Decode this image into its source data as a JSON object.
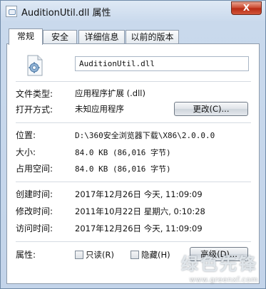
{
  "window": {
    "title": "AuditionUtil.dll 属性",
    "close_label": "X"
  },
  "tabs": [
    {
      "label": "常规",
      "active": true
    },
    {
      "label": "安全",
      "active": false
    },
    {
      "label": "详细信息",
      "active": false
    },
    {
      "label": "以前的版本",
      "active": false
    }
  ],
  "general": {
    "filename": "AuditionUtil.dll",
    "file_type_label": "文件类型:",
    "file_type_value": "应用程序扩展 (.dll)",
    "open_with_label": "打开方式:",
    "open_with_value": "未知应用程序",
    "change_button": "更改(C)...",
    "location_label": "位置:",
    "location_value": "D:\\360安全浏览器下载\\X86\\2.0.0.0",
    "size_label": "大小:",
    "size_value": "84.0 KB (86,016 字节)",
    "size_on_disk_label": "占用空间:",
    "size_on_disk_value": "84.0 KB (86,016 字节)",
    "created_label": "创建时间:",
    "created_value": "2017年12月26日 今天, 11:09:09",
    "modified_label": "修改时间:",
    "modified_value": "2011年10月22日 星期六, 0:10:28",
    "accessed_label": "访问时间:",
    "accessed_value": "2017年12月26日 今天, 11:09:09",
    "attributes_label": "属性:",
    "readonly_label": "只读(R)",
    "hidden_label": "隐藏(H)",
    "advanced_button": "高级(D)..."
  },
  "watermark": {
    "text": "绿色先锋",
    "url": "www.greenxf.com"
  },
  "colors": {
    "window_frame": "#c3d4ea",
    "close_button": "#c9442a",
    "panel": "#ffffff"
  },
  "icons": {
    "title_icon": "dll-file-icon",
    "file_icon": "gear-document-icon"
  }
}
